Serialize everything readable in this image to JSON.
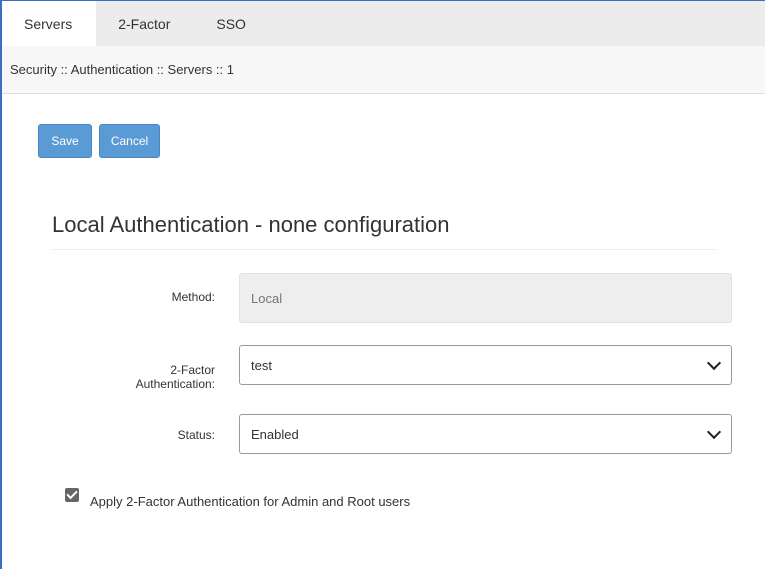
{
  "tabs": [
    {
      "label": "Servers",
      "active": true
    },
    {
      "label": "2-Factor",
      "active": false
    },
    {
      "label": "SSO",
      "active": false
    }
  ],
  "breadcrumb": "Security :: Authentication :: Servers :: 1",
  "toolbar": {
    "save_label": "Save",
    "cancel_label": "Cancel"
  },
  "section": {
    "title": "Local Authentication - none configuration"
  },
  "form": {
    "method": {
      "label": "Method:",
      "value": "Local"
    },
    "two_factor": {
      "label_line1": "2-Factor",
      "label_line2": "Authentication:",
      "value": "test"
    },
    "status": {
      "label": "Status:",
      "value": "Enabled"
    },
    "apply_2fa": {
      "label": "Apply 2-Factor Authentication for Admin and Root users",
      "checked": true
    }
  },
  "colors": {
    "accent": "#5b9bd5",
    "frame": "#3a70c0"
  }
}
